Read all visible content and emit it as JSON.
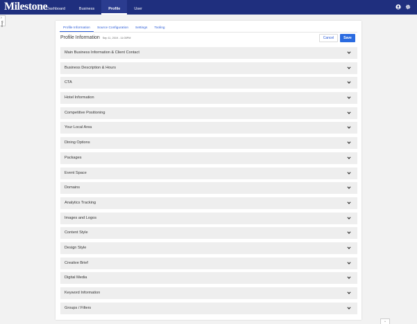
{
  "header": {
    "logo": "Milestone",
    "nav": [
      {
        "label": "Dashboard"
      },
      {
        "label": "Business"
      },
      {
        "label": "Profile"
      },
      {
        "label": "User"
      }
    ],
    "icons": [
      "account-icon",
      "gear-icon"
    ]
  },
  "sidebar": {
    "menu_label": "Menu"
  },
  "subtabs": [
    {
      "label": "Profile Information"
    },
    {
      "label": "Source Configuration"
    },
    {
      "label": "Settings"
    },
    {
      "label": "Tooling"
    }
  ],
  "page": {
    "title": "Profile Information",
    "date": "Sep 11, 2019 - 11:03PM",
    "cancel_label": "Cancel",
    "save_label": "Save"
  },
  "sections": [
    {
      "label": "Main Business Information & Client Contact"
    },
    {
      "label": "Business Description & Hours"
    },
    {
      "label": "CTA"
    },
    {
      "label": "Hotel Information"
    },
    {
      "label": "Competitive Positioning"
    },
    {
      "label": "Your Local Area"
    },
    {
      "label": "Dining Options"
    },
    {
      "label": "Packages"
    },
    {
      "label": "Event Space"
    },
    {
      "label": "Domains"
    },
    {
      "label": "Analytics Tracking"
    },
    {
      "label": "Images and Logos"
    },
    {
      "label": "Content Style"
    },
    {
      "label": "Design Style"
    },
    {
      "label": "Creative Brief"
    },
    {
      "label": "Digital Media"
    },
    {
      "label": "Keyword Information"
    },
    {
      "label": "Groups / Filters"
    }
  ],
  "colors": {
    "header_bg": "#1f2f7e",
    "accent": "#2a6be0",
    "section_bg": "#eeeeee"
  }
}
